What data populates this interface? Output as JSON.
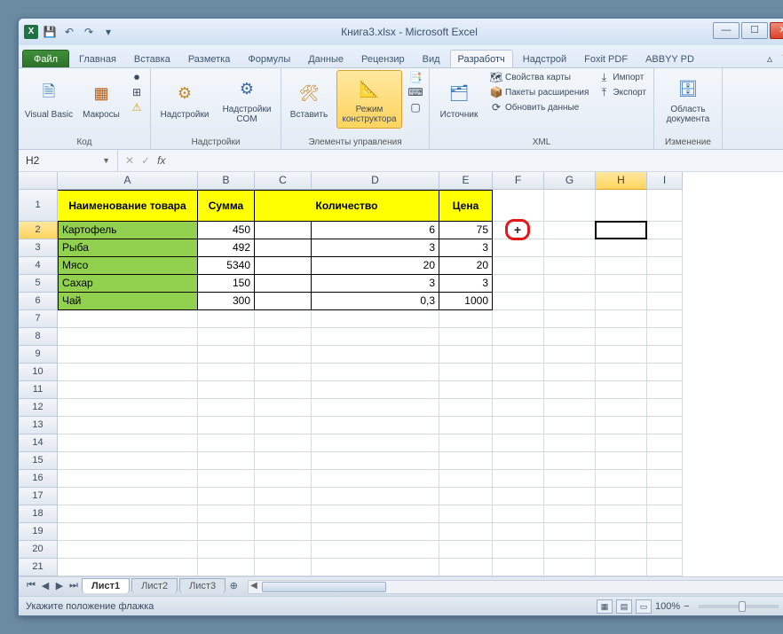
{
  "title": "Книга3.xlsx - Microsoft Excel",
  "qat": {
    "save": "💾",
    "undo": "↶",
    "redo": "↷"
  },
  "tabs": {
    "file": "Файл",
    "items": [
      "Главная",
      "Вставка",
      "Разметка",
      "Формулы",
      "Данные",
      "Рецензир",
      "Вид",
      "Разработч",
      "Надстрой",
      "Foxit PDF",
      "ABBYY PD"
    ],
    "active_index": 7
  },
  "ribbon": {
    "code": {
      "visual_basic": "Visual Basic",
      "macros": "Макросы",
      "label": "Код"
    },
    "addins": {
      "addins": "Надстройки",
      "com": "Надстройки COM",
      "label": "Надстройки"
    },
    "controls": {
      "insert": "Вставить",
      "design": "Режим конструктора",
      "label": "Элементы управления"
    },
    "xml": {
      "source": "Источник",
      "map_props": "Свойства карты",
      "packs": "Пакеты расширения",
      "refresh": "Обновить данные",
      "import": "Импорт",
      "export": "Экспорт",
      "label": "XML"
    },
    "doc": {
      "panel": "Область документа",
      "label": "Изменение"
    }
  },
  "namebox": "H2",
  "fx": "fx",
  "columns": {
    "letters": [
      "A",
      "B",
      "C",
      "D",
      "E",
      "F",
      "G",
      "H",
      "I"
    ],
    "widths": [
      158,
      64,
      64,
      144,
      60,
      58,
      58,
      58,
      40
    ],
    "active": 7
  },
  "row_active": 2,
  "header_row": {
    "a": "Наименование товара",
    "b": "Сумма",
    "cd": "Количество",
    "e": "Цена"
  },
  "data_rows": [
    {
      "name": "Картофель",
      "sum": "450",
      "qty": "6",
      "price": "75"
    },
    {
      "name": "Рыба",
      "sum": "492",
      "qty": "3",
      "price": "3"
    },
    {
      "name": "Мясо",
      "sum": "5340",
      "qty": "20",
      "price": "20"
    },
    {
      "name": "Сахар",
      "sum": "150",
      "qty": "3",
      "price": "3"
    },
    {
      "name": "Чай",
      "sum": "300",
      "qty": "0,3",
      "price": "1000"
    }
  ],
  "selected": {
    "col": "H",
    "row": 2
  },
  "drawing_cursor": "+",
  "sheets": {
    "active": "Лист1",
    "others": [
      "Лист2",
      "Лист3"
    ],
    "add": "⊕"
  },
  "status": "Укажите положение флажка",
  "zoom": {
    "pct": "100%",
    "minus": "−",
    "plus": "+"
  }
}
